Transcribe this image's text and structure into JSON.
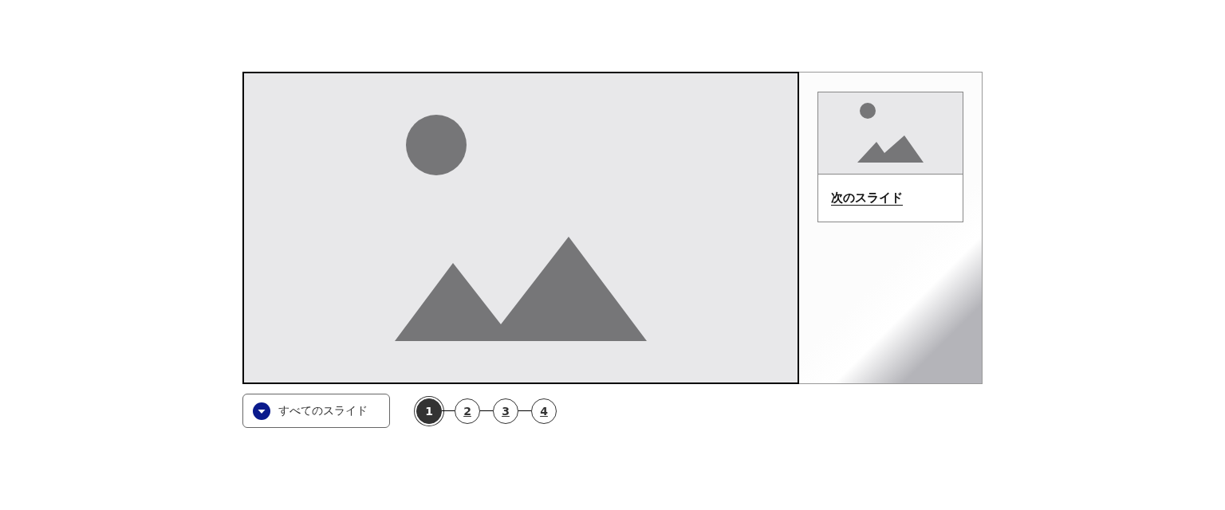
{
  "next_slide": {
    "label": "次のスライド"
  },
  "all_slides_button": {
    "label": "すべてのスライド",
    "expanded": false
  },
  "pages": [
    {
      "label": "1",
      "selected": true
    },
    {
      "label": "2",
      "selected": false
    },
    {
      "label": "3",
      "selected": false
    },
    {
      "label": "4",
      "selected": false
    }
  ]
}
